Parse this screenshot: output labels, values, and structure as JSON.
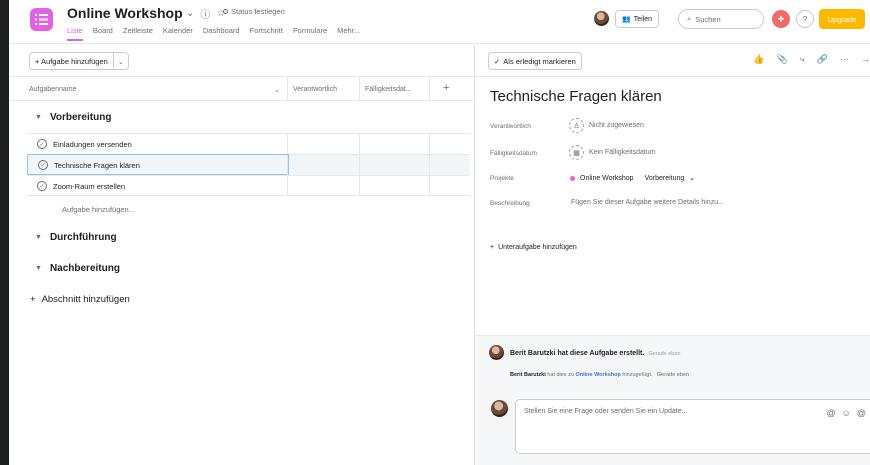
{
  "header": {
    "project_title": "Online Workshop",
    "status_label": "Status festlegen",
    "tabs": [
      "Liste",
      "Board",
      "Zeitleiste",
      "Kalender",
      "Dashboard",
      "Fortschritt",
      "Formulare",
      "Mehr..."
    ],
    "share_label": "Teilen",
    "search_placeholder": "Suchen",
    "upgrade_label": "Upgrade",
    "help_label": "?"
  },
  "list": {
    "add_task_label": "+ Aufgabe hinzufügen",
    "columns": [
      "Aufgabenname",
      "Verantwortlich",
      "Fälligkeitsdat...",
      "+"
    ],
    "sections": [
      {
        "name": "Vorbereitung",
        "tasks": [
          "Einladungen versenden",
          "Technische Fragen klären",
          "Zoom-Raum erstellen"
        ],
        "add_task": "Aufgabe hinzufügen..."
      },
      {
        "name": "Durchführung",
        "tasks": []
      },
      {
        "name": "Nachbereitung",
        "tasks": []
      }
    ],
    "add_section_label": "Abschnitt hinzufügen"
  },
  "detail": {
    "mark_done_label": "Als erledigt markieren",
    "task_title": "Technische Fragen klären",
    "fields": {
      "assignee_label": "Verantwortlich",
      "assignee_value": "Nicht zugewiesen",
      "due_label": "Fälligkeitsdatum",
      "due_value": "Kein Fälligkeitsdatum",
      "projects_label": "Projekte",
      "project_name": "Online Workshop",
      "project_section": "Vorbereitung",
      "description_label": "Beschreibung",
      "description_placeholder": "Fügen Sie dieser Aufgabe weitere Details hinzu..."
    },
    "add_subtask_label": "Unteraufgabe hinzufügen",
    "activity": {
      "created_text": "Berit Barutzki hat diese Aufgabe erstellt.",
      "created_time": "Gerade eben",
      "added_user": "Berit Barutzki",
      "added_mid": "hat dies zu",
      "added_project": "Online Workshop",
      "added_end": "hinzugefügt.",
      "added_time": "Gerade eben"
    },
    "comment_placeholder": "Stellen Sie eine Frage oder senden Sie ein Update..."
  },
  "colors": {
    "accent": "#e362e3",
    "upgrade": "#fcb900",
    "plus": "#f06a6a",
    "link": "#4573d2",
    "selection_border": "#8ec2ef"
  }
}
